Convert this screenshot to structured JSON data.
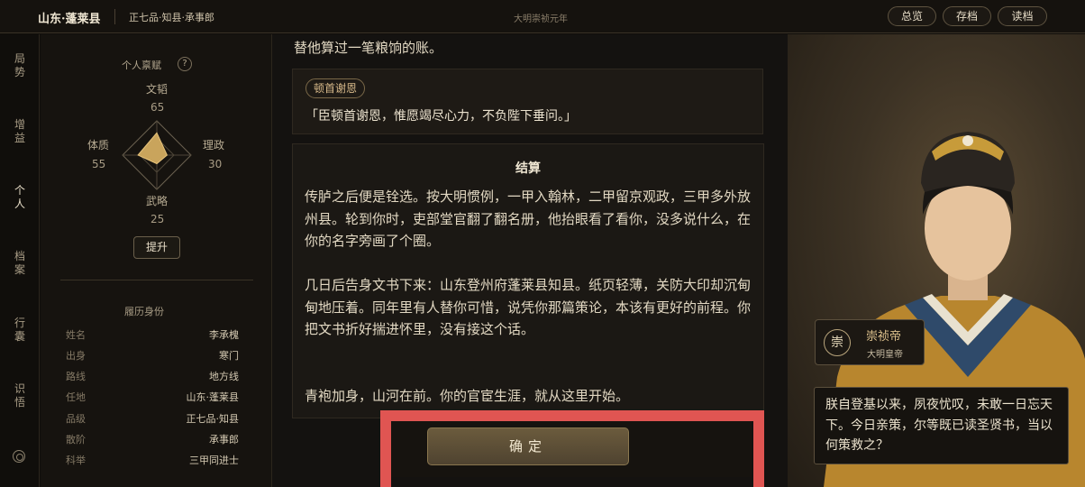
{
  "topbar": {
    "region": "山东·蓬莱县",
    "rank": "正七品·知县·承事郎",
    "era": "大明崇祯元年",
    "buttons": {
      "overview": "总览",
      "save": "存档",
      "load": "读档"
    }
  },
  "nav": {
    "items": [
      {
        "c1": "局",
        "c2": "势"
      },
      {
        "c1": "增",
        "c2": "益"
      },
      {
        "c1": "个",
        "c2": "人"
      },
      {
        "c1": "档",
        "c2": "案"
      },
      {
        "c1": "行",
        "c2": "囊"
      },
      {
        "c1": "识",
        "c2": "悟"
      }
    ],
    "active_index": 2,
    "settings_icon": "gear-icon"
  },
  "talent": {
    "title": "个人禀赋",
    "help": "?",
    "stats": {
      "literary": {
        "label": "文韬",
        "value": 65
      },
      "governance": {
        "label": "理政",
        "value": 30
      },
      "martial": {
        "label": "武略",
        "value": 25
      },
      "physique": {
        "label": "体质",
        "value": 55
      }
    },
    "promote_label": "提升"
  },
  "resume": {
    "title": "履历身份",
    "rows": [
      {
        "k": "姓名",
        "v": "李承槐"
      },
      {
        "k": "出身",
        "v": "寒门"
      },
      {
        "k": "路线",
        "v": "地方线"
      },
      {
        "k": "任地",
        "v": "山东·蓬莱县"
      },
      {
        "k": "品级",
        "v": "正七品·知县"
      },
      {
        "k": "散阶",
        "v": "承事郎"
      },
      {
        "k": "科举",
        "v": "三甲同进士"
      }
    ]
  },
  "story": {
    "top_line": "替他算过一笔粮饷的账。",
    "choice": {
      "tag": "顿首谢恩",
      "quote": "「臣顿首谢恩，惟愿竭尽心力，不负陛下垂问。」"
    },
    "settlement": {
      "title": "结算",
      "paragraphs": [
        "传胪之后便是铨选。按大明惯例，一甲入翰林，二甲留京观政，三甲多外放州县。轮到你时，吏部堂官翻了翻名册，他抬眼看了看你，没多说什么，在你的名字旁画了个圈。",
        "几日后告身文书下来：山东登州府蓬莱县知县。纸页轻薄，关防大印却沉甸甸地压着。同年里有人替你可惜，说凭你那篇策论，本该有更好的前程。你把文书折好揣进怀里，没有接这个话。",
        "青袍加身，山河在前。你的官宦生涯，就从这里开始。"
      ]
    },
    "confirm_label": "确定"
  },
  "speaker": {
    "seal": "崇",
    "name": "崇祯帝",
    "title": "大明皇帝",
    "speech": "朕自登基以来，夙夜忧叹，未敢一日忘天下。今日亲策，尔等既已读圣贤书，当以何策救之？"
  },
  "colors": {
    "accent_gold": "#d7b98a",
    "highlight_red": "#e05552",
    "background": "#141210"
  }
}
